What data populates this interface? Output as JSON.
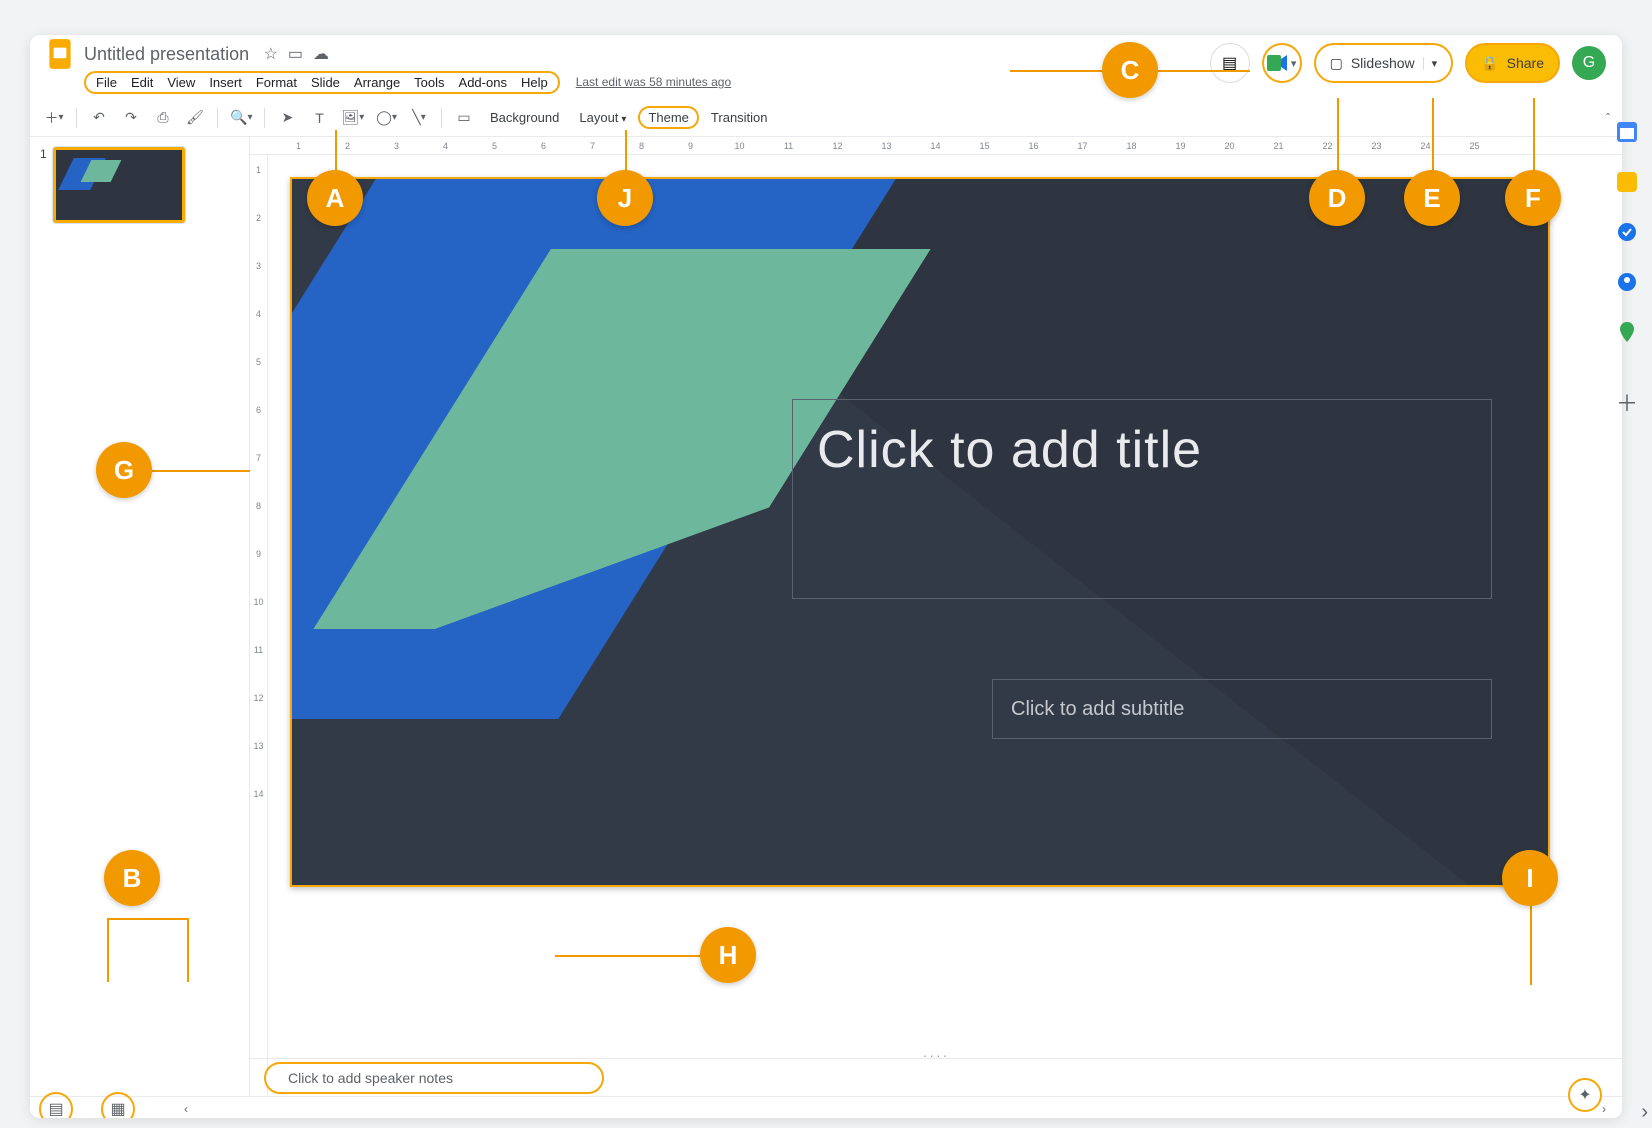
{
  "document": {
    "name": "Untitled presentation",
    "last_edit": "Last edit was 58 minutes ago"
  },
  "menubar": {
    "items": [
      "File",
      "Edit",
      "View",
      "Insert",
      "Format",
      "Slide",
      "Arrange",
      "Tools",
      "Add-ons",
      "Help"
    ]
  },
  "header_actions": {
    "slideshow_label": "Slideshow",
    "share_label": "Share",
    "avatar_letter": "G"
  },
  "toolbar": {
    "background_label": "Background",
    "layout_label": "Layout",
    "theme_label": "Theme",
    "transition_label": "Transition"
  },
  "ruler": {
    "h": [
      "1",
      "2",
      "3",
      "4",
      "5",
      "6",
      "7",
      "8",
      "9",
      "10",
      "11",
      "12",
      "13",
      "14",
      "15",
      "16",
      "17",
      "18",
      "19",
      "20",
      "21",
      "22",
      "23",
      "24",
      "25"
    ],
    "v": [
      "1",
      "2",
      "3",
      "4",
      "5",
      "6",
      "7",
      "8",
      "9",
      "10",
      "11",
      "12",
      "13",
      "14"
    ]
  },
  "slide": {
    "number": "1",
    "title_placeholder": "Click to add title",
    "subtitle_placeholder": "Click to add subtitle"
  },
  "speaker_notes": {
    "placeholder": "Click to add speaker notes"
  },
  "callouts": {
    "A": "A",
    "B": "B",
    "C": "C",
    "D": "D",
    "E": "E",
    "F": "F",
    "G": "G",
    "H": "H",
    "I": "I",
    "J": "J"
  },
  "icons": {
    "star": "☆",
    "move": "▭",
    "cloud": "☁",
    "comment": "▤",
    "present": "▢",
    "lock": "🔒",
    "chevron_down": "▾",
    "chevron_up": "ˆ",
    "chevron_left": "‹",
    "chevron_right": "›",
    "plus": "＋",
    "explore": "✦",
    "filmstrip": "▤",
    "grid": "▦"
  }
}
